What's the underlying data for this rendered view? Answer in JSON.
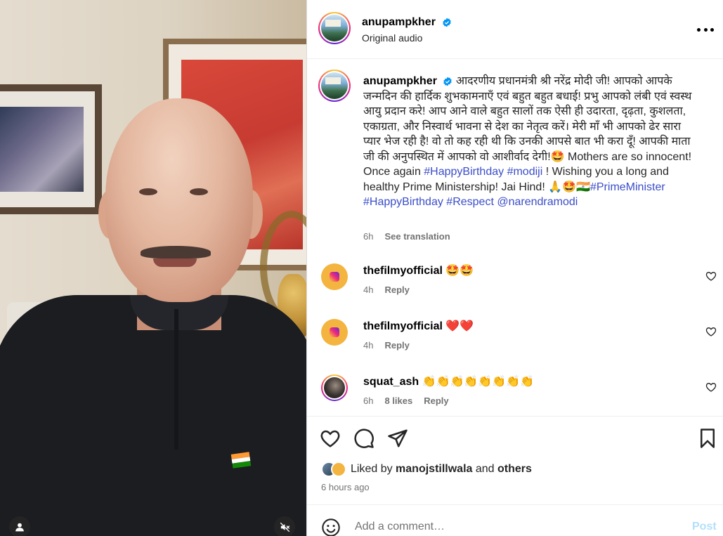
{
  "header": {
    "username": "anupampkher",
    "subtitle": "Original audio",
    "more_icon": "more-horizontal-icon"
  },
  "caption": {
    "username": "anupampkher",
    "text_hindi": "आदरणीय प्रधानमंत्री श्री नरेंद्र मोदी जी! आपको आपके जन्मदिन की हार्दिक शुभकामनाएँ एवं बहुत बहुत बधाई! प्रभु आपको लंबी एवं स्वस्थ आयु प्रदान करे! आप आने वाले बहुत सालों तक ऐसी ही उदारता, दृढ़ता, कुशलता, एकाग्रता, और निस्वार्थ भावना से देश का नेतृत्व करें। मेरी माँ भी आपको ढेर सारा प्यार भेज रही है! वो तो कह रही थी कि उनकी आपसे बात भी करा दूँ! आपकी माता जी की अनुपस्थित में आपको वो आशीर्वाद देगी!🤩 Mothers are so innocent! Once again ",
    "tag1": "#HappyBirthday",
    "tag2": "#modiji",
    "text_mid": " ! Wishing you a long and healthy Prime Ministership! Jai Hind! 🙏🤩🇮🇳",
    "tag3": "#PrimeMinister",
    "tag4": "#HappyBirthday",
    "tag5": "#Respect",
    "mention": "@narendramodi",
    "time": "6h",
    "see_translation": "See translation"
  },
  "comments": [
    {
      "username": "thefilmyofficial",
      "text": "🤩🤩",
      "time": "4h",
      "reply": "Reply",
      "likes": ""
    },
    {
      "username": "thefilmyofficial",
      "text": "❤️❤️",
      "time": "4h",
      "reply": "Reply",
      "likes": ""
    },
    {
      "username": "squat_ash",
      "text": "👏👏👏👏👏👏👏👏",
      "time": "6h",
      "reply": "Reply",
      "likes": "8 likes"
    }
  ],
  "actions": {
    "liked_by_prefix": "Liked by ",
    "liked_by_user": "manojstillwala",
    "liked_by_and": " and ",
    "liked_by_others": "others",
    "posted_time": "6 hours ago"
  },
  "add_comment": {
    "placeholder": "Add a comment…",
    "post_label": "Post"
  },
  "colors": {
    "link": "#3b4ec9",
    "verified": "#0095f6",
    "post_disabled": "#b2dffc"
  }
}
